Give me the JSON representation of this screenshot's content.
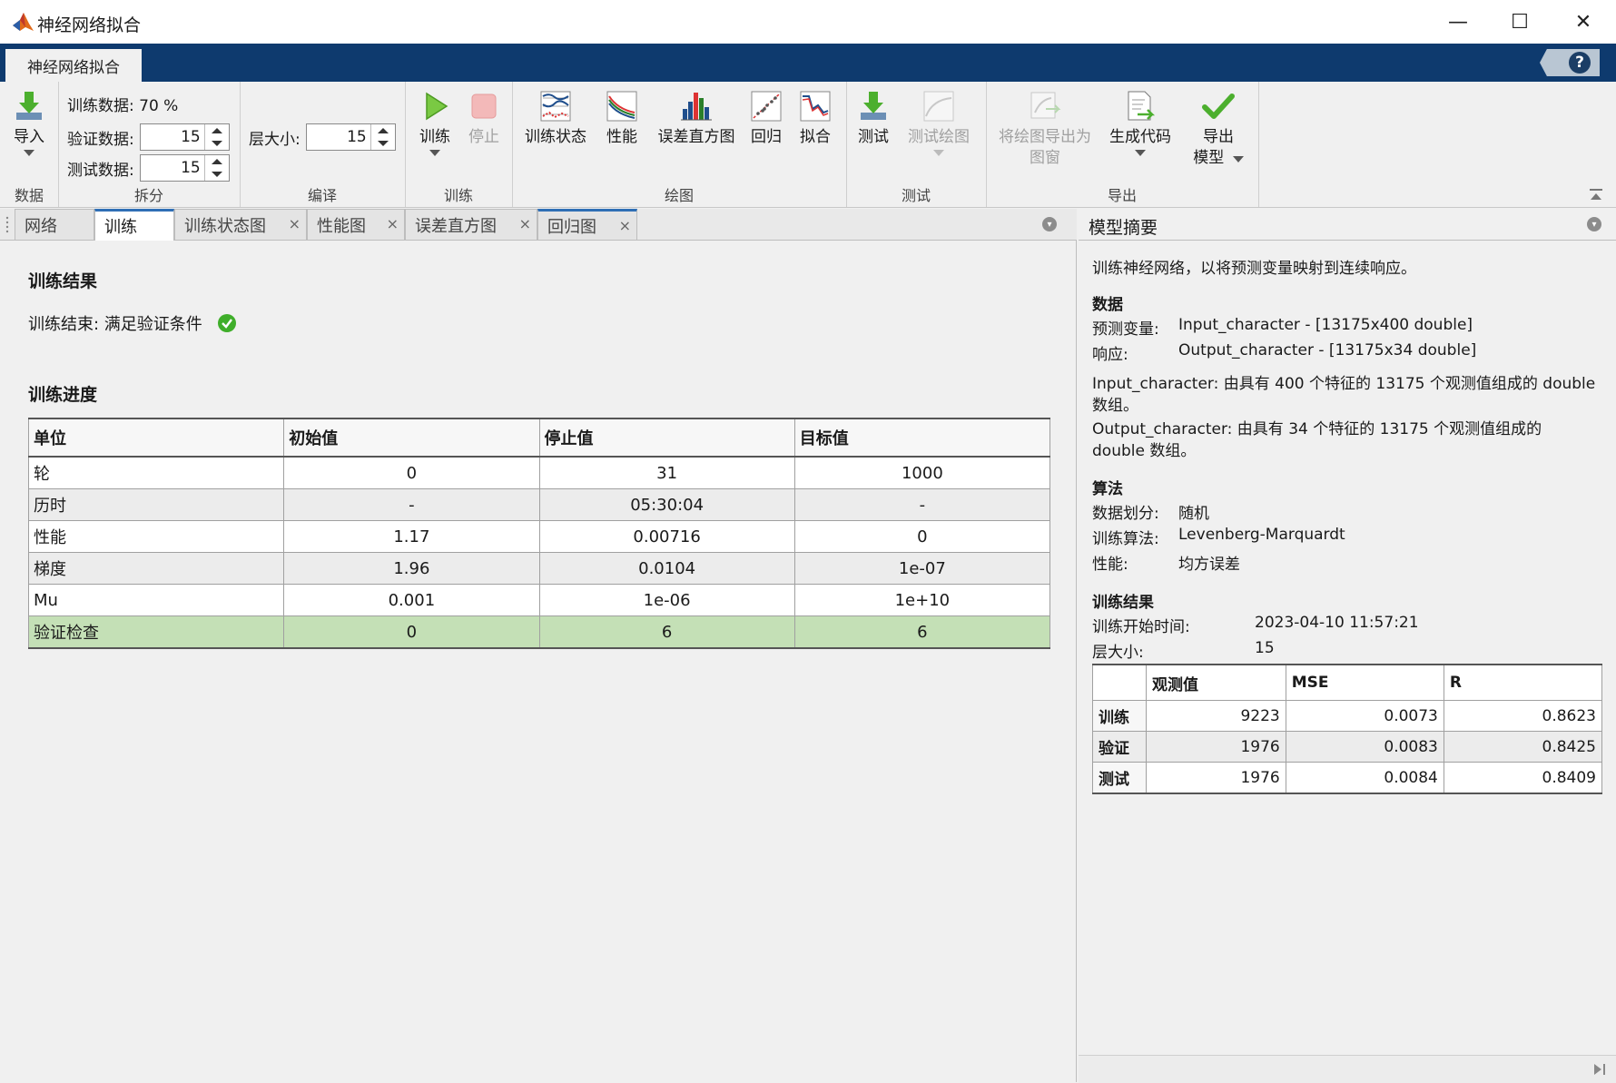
{
  "window": {
    "title": "神经网络拟合",
    "minimize_glyph": "—",
    "maximize_glyph": "☐",
    "close_glyph": "✕"
  },
  "ribbon": {
    "tab_label": "神经网络拟合",
    "help_glyph": "?"
  },
  "toolstrip": {
    "data": {
      "import_label": "导入",
      "section_label": "数据"
    },
    "split": {
      "train_text": "训练数据: 70 %",
      "validation_label": "验证数据:",
      "validation_value": "15",
      "test_label": "测试数据:",
      "test_value": "15",
      "section_label": "拆分"
    },
    "compile": {
      "layer_size_label": "层大小:",
      "layer_size_value": "15",
      "section_label": "编译"
    },
    "train": {
      "train_label": "训练",
      "stop_label": "停止",
      "section_label": "训练"
    },
    "plots": {
      "training_state_label": "训练状态",
      "performance_label": "性能",
      "error_histogram_label": "误差直方图",
      "regression_label": "回归",
      "fit_label": "拟合",
      "section_label": "绘图"
    },
    "test": {
      "test_label": "测试",
      "test_plot_label": "测试绘图",
      "section_label": "测试"
    },
    "export": {
      "export_plot_line1": "将绘图导出为",
      "export_plot_line2": "图窗",
      "generate_code_label": "生成代码",
      "export_model_line1": "导出",
      "export_model_line2": "模型",
      "section_label": "导出"
    }
  },
  "doc_tabs": [
    {
      "label": "网络"
    },
    {
      "label": "训练"
    },
    {
      "label": "训练状态图"
    },
    {
      "label": "性能图"
    },
    {
      "label": "误差直方图"
    },
    {
      "label": "回归图"
    }
  ],
  "tab_close_glyph": "×",
  "training": {
    "results_heading": "训练结果",
    "results_text": "训练结束: 满足验证条件",
    "progress_heading": "训练进度",
    "progress_table": {
      "headers": [
        "单位",
        "初始值",
        "停止值",
        "目标值"
      ],
      "rows": [
        [
          "轮",
          "0",
          "31",
          "1000"
        ],
        [
          "历时",
          "-",
          "05:30:04",
          "-"
        ],
        [
          "性能",
          "1.17",
          "0.00716",
          "0"
        ],
        [
          "梯度",
          "1.96",
          "0.0104",
          "1e-07"
        ],
        [
          "Mu",
          "0.001",
          "1e-06",
          "1e+10"
        ],
        [
          "验证检查",
          "0",
          "6",
          "6"
        ]
      ]
    }
  },
  "summary": {
    "title": "模型摘要",
    "intro": "训练神经网络，以将预测变量映射到连续响应。",
    "data_heading": "数据",
    "predictor_label": "预测变量:",
    "predictor_value": "Input_character - [13175x400 double]",
    "response_label": "响应:",
    "response_value": "Output_character - [13175x34 double]",
    "input_desc": "Input_character: 由具有 400 个特征的 13175 个观测值组成的 double 数组。",
    "output_desc": "Output_character: 由具有 34 个特征的 13175 个观测值组成的 double 数组。",
    "algo_heading": "算法",
    "split_label": "数据划分:",
    "split_value": "随机",
    "train_algo_label": "训练算法:",
    "train_algo_value": "Levenberg-Marquardt",
    "perf_label": "性能:",
    "perf_value": "均方误差",
    "results_heading": "训练结果",
    "start_time_label": "训练开始时间:",
    "start_time_value": "2023-04-10 11:57:21",
    "layer_size_label": "层大小:",
    "layer_size_value": "15",
    "results_table": {
      "headers": [
        "",
        "观测值",
        "MSE",
        "R"
      ],
      "rows": [
        [
          "训练",
          "9223",
          "0.0073",
          "0.8623"
        ],
        [
          "验证",
          "1976",
          "0.0083",
          "0.8425"
        ],
        [
          "测试",
          "1976",
          "0.0084",
          "0.8409"
        ]
      ]
    }
  },
  "colors": {
    "ribbon_blue": "#0e3a6e",
    "highlight_row": "#c4e0b6",
    "success_green": "#3fae2a",
    "active_tab_accent": "#2f6fb5"
  }
}
